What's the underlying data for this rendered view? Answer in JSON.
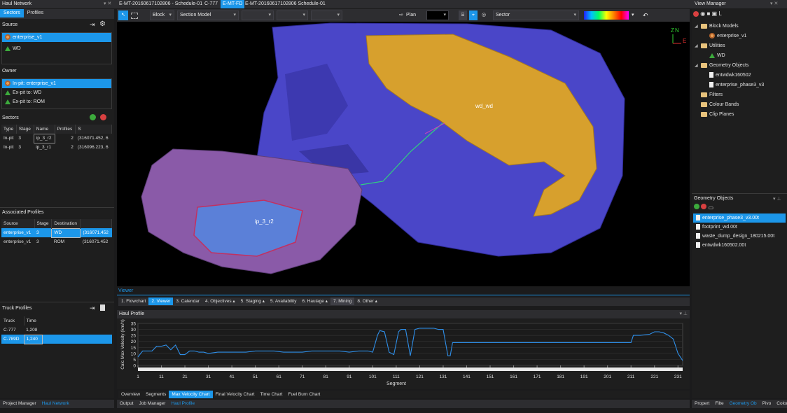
{
  "top_tabs": [
    "Haul Network",
    "E-MT-20160617102806 - Schedule-01",
    "C-777",
    "E-MT-FD",
    "E-MT-20160617102806 Schedule-01"
  ],
  "left": {
    "tabs": [
      "Sectors",
      "Profiles"
    ],
    "source_title": "Source",
    "source_items": [
      "enterprise_v1",
      "WD"
    ],
    "owner_title": "Owner",
    "owner_items": [
      "In-pit: enterprise_v1",
      "Ex-pit to: WD",
      "Ex-pit to: ROM"
    ],
    "sectors_title": "Sectors",
    "sectors_headers": [
      "Type",
      "Stage",
      "Name",
      "Profiles",
      "S"
    ],
    "sectors_rows": [
      [
        "In-pit",
        "3",
        "ip_3_r2",
        "2",
        "(316071.452, 6"
      ],
      [
        "In-pit",
        "3",
        "ip_3_r1",
        "2",
        "(316096.223, 6"
      ]
    ],
    "assoc_title": "Associated Profiles",
    "assoc_headers": [
      "Source",
      "Stage",
      "Destination",
      ""
    ],
    "assoc_rows": [
      [
        "enterprise_v1",
        "3",
        "WD",
        "(316071.452"
      ],
      [
        "enterprise_v1",
        "3",
        "ROM",
        "(316071.452"
      ]
    ],
    "truck_title": "Truck Profiles",
    "truck_headers": [
      "Truck",
      "Time"
    ],
    "truck_rows": [
      [
        "C-777",
        "1,208"
      ],
      [
        "C-789D",
        "1,240"
      ]
    ],
    "bottom_tabs": [
      "Project Manager",
      "Haul Network"
    ]
  },
  "toolbar": {
    "block": "Block",
    "section_model": "Section Model",
    "plan": "Plan",
    "sector": "Sector"
  },
  "viewport": {
    "labels": [
      "wd_wd",
      "ip_3_r2"
    ],
    "axis_z": "Z",
    "axis_n": "N",
    "axis_e": "E"
  },
  "viewer_label": "Viewer",
  "center_tabs": [
    "1. Flowchart",
    "2. Viewer",
    "3. Calendar",
    "4. Objectives ▴",
    "5. Staging ▴",
    "5. Availability",
    "6. Haulage ▴",
    "7. Mining",
    "8. Other ▴"
  ],
  "haul_profile_title": "Haul Profile",
  "chart_data": {
    "type": "line",
    "ylabel": "Calc Max Velocity (km/h)",
    "xlabel": "Segment",
    "ylim": [
      0,
      35
    ],
    "yticks": [
      0,
      5,
      10,
      15,
      20,
      25,
      30,
      35
    ],
    "xticks": [
      1,
      11,
      21,
      31,
      41,
      51,
      61,
      71,
      81,
      91,
      101,
      111,
      121,
      131,
      141,
      151,
      161,
      171,
      181,
      191,
      201,
      211,
      221,
      231
    ],
    "x": [
      1,
      3,
      5,
      7,
      9,
      11,
      13,
      15,
      17,
      19,
      21,
      23,
      25,
      27,
      29,
      31,
      35,
      39,
      43,
      47,
      51,
      55,
      59,
      63,
      67,
      71,
      75,
      79,
      83,
      87,
      91,
      95,
      99,
      101,
      103,
      104,
      106,
      108,
      110,
      112,
      113,
      114,
      115,
      117,
      119,
      121,
      123,
      125,
      127,
      129,
      131,
      133,
      134,
      135,
      137,
      141,
      151,
      161,
      171,
      181,
      191,
      201,
      211,
      212,
      215,
      219,
      221,
      223,
      225,
      227,
      229,
      231,
      233
    ],
    "y": [
      7,
      12,
      12,
      12,
      16,
      16,
      17,
      13,
      17,
      9,
      9,
      12,
      12,
      11,
      11,
      10,
      11,
      11,
      11,
      11,
      12,
      12,
      12,
      11,
      11,
      11,
      12,
      12,
      12,
      12,
      11,
      12,
      12,
      11,
      25,
      29,
      28,
      11,
      9,
      28,
      30,
      30,
      30,
      8,
      30,
      31,
      31,
      31,
      31,
      30,
      30,
      8,
      8,
      19,
      19,
      19,
      19,
      19,
      19,
      19,
      19,
      19,
      19,
      25,
      25,
      26,
      28,
      28,
      27,
      25,
      22,
      10,
      4
    ]
  },
  "chart_bottom_tabs": [
    "Overview",
    "Segments",
    "Max Velocity Chart",
    "Final Velocity Chart",
    "Time Chart",
    "Fuel Burn Chart"
  ],
  "center_bottom_tabs": [
    "Output",
    "Job Manager",
    "Haul Profile"
  ],
  "right": {
    "view_manager_title": "View Manager",
    "tree": [
      {
        "label": "Block Models",
        "level": 0,
        "icon": "folder"
      },
      {
        "label": "enterprise_v1",
        "level": 1,
        "icon": "block"
      },
      {
        "label": "Utilities",
        "level": 0,
        "icon": "folder"
      },
      {
        "label": "WD",
        "level": 1,
        "icon": "tri"
      },
      {
        "label": "Geometry Objects",
        "level": 0,
        "icon": "folder"
      },
      {
        "label": "entwdwk160502",
        "level": 1,
        "icon": "file"
      },
      {
        "label": "enterprise_phase3_v3",
        "level": 1,
        "icon": "file"
      },
      {
        "label": "Filters",
        "level": 0,
        "icon": "folder"
      },
      {
        "label": "Colour Bands",
        "level": 0,
        "icon": "folder"
      },
      {
        "label": "Clip Planes",
        "level": 0,
        "icon": "folder"
      }
    ],
    "geom_title": "Geometry Objects",
    "geom_items": [
      "enterprise_phase3_v3.00t",
      "footprint_wd.00t",
      "waste_dump_design_180215.00t",
      "entwdwk160502.00t"
    ],
    "bottom_tabs": [
      "Propert",
      "Filte",
      "Geometry Ob",
      "Pivo",
      "Colou"
    ]
  },
  "colors": {
    "accent": "#1c97ea",
    "pit": "#8a5aa8",
    "dump": "#4a46c8",
    "blocks": "#d7a02d"
  }
}
